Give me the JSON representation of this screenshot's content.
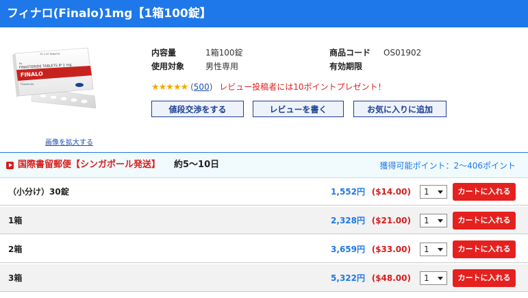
{
  "product": {
    "title": "フィナロ(Finalo)1mg【1箱100錠】",
    "enlarge_link": "画像を拡大する",
    "package_text": {
      "brand": "FINALO",
      "drug": "FINASTERIDE TABLETS IP 1 mg",
      "sub": "Finasteride",
      "count": "10 x 10 TABLETS",
      "rx": "Rx"
    },
    "specs": {
      "content_label": "内容量",
      "content_value": "1箱100錠",
      "target_label": "使用対象",
      "target_value": "男性専用",
      "code_label": "商品コード",
      "code_value": "OS01902",
      "expiry_label": "有効期限"
    },
    "rating": {
      "stars": "★★★★★",
      "score": 4.5,
      "paren_open": "(",
      "review_count": "500",
      "paren_close": ")",
      "promo": "レビュー投稿者には10ポイントプレゼント！"
    },
    "buttons": {
      "negotiate": "値段交渉をする",
      "write_review": "レビューを書く",
      "favorite": "お気に入りに追加"
    }
  },
  "shipping": {
    "method": "国際書留郵便【シンガポール発送】",
    "days": "約5～10日",
    "points": "獲得可能ポイント：2～406ポイント"
  },
  "options": [
    {
      "label": "（小分け）30錠",
      "price_jpy": "1,552円",
      "price_usd": "($14.00)",
      "qty": "1",
      "cart": "カートに入れる"
    },
    {
      "label": "1箱",
      "price_jpy": "2,328円",
      "price_usd": "($21.00)",
      "qty": "1",
      "cart": "カートに入れる"
    },
    {
      "label": "2箱",
      "price_jpy": "3,659円",
      "price_usd": "($33.00)",
      "qty": "1",
      "cart": "カートに入れる"
    },
    {
      "label": "3箱",
      "price_jpy": "5,322円",
      "price_usd": "($48.00)",
      "qty": "1",
      "cart": "カートに入れる"
    }
  ],
  "colors": {
    "header_blue": "#1e78ea",
    "price_blue": "#1e78ea",
    "price_red": "#d81c1c",
    "cart_red": "#e5211f",
    "button_border": "#1b3f94",
    "star": "#f2a800"
  }
}
